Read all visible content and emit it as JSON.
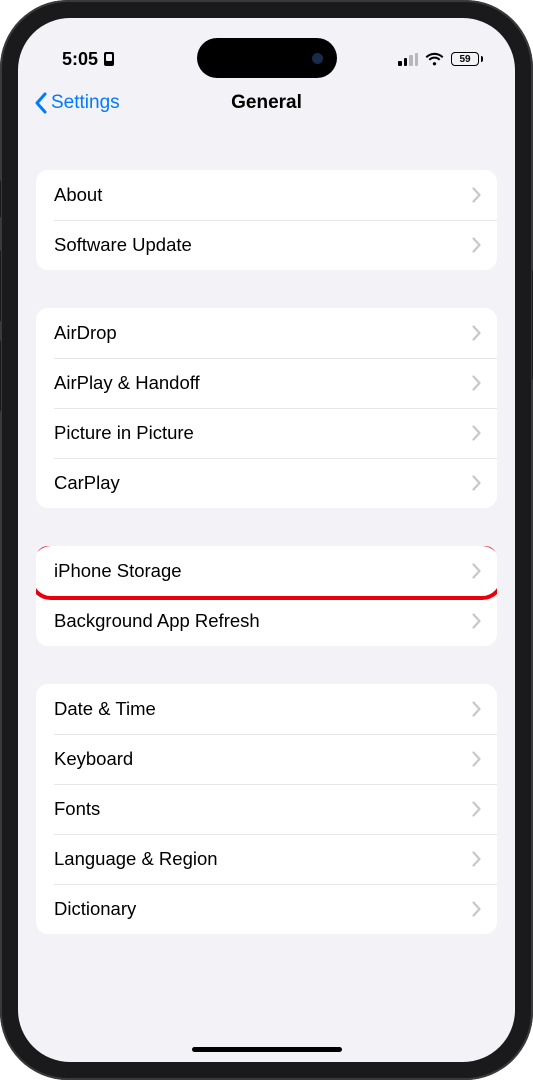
{
  "status": {
    "time": "5:05",
    "battery_pct": "59"
  },
  "nav": {
    "back_label": "Settings",
    "title": "General"
  },
  "groups": [
    {
      "items": [
        {
          "label": "About"
        },
        {
          "label": "Software Update"
        }
      ]
    },
    {
      "items": [
        {
          "label": "AirDrop"
        },
        {
          "label": "AirPlay & Handoff"
        },
        {
          "label": "Picture in Picture"
        },
        {
          "label": "CarPlay"
        }
      ]
    },
    {
      "items": [
        {
          "label": "iPhone Storage",
          "highlighted": true
        },
        {
          "label": "Background App Refresh"
        }
      ]
    },
    {
      "items": [
        {
          "label": "Date & Time"
        },
        {
          "label": "Keyboard"
        },
        {
          "label": "Fonts"
        },
        {
          "label": "Language & Region"
        },
        {
          "label": "Dictionary"
        }
      ]
    }
  ]
}
